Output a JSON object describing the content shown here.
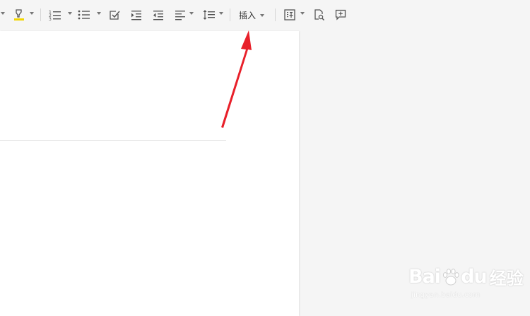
{
  "toolbar": {
    "insert_label": "插入",
    "icons": [
      "caret-down-icon",
      "highlight-marker-icon",
      "numbered-list-icon",
      "bulleted-list-icon",
      "checklist-icon",
      "increase-indent-icon",
      "decrease-indent-icon",
      "align-left-icon",
      "line-spacing-icon",
      "translate-icon",
      "find-document-icon",
      "add-comment-icon"
    ]
  },
  "colors": {
    "background": "#f5f5f5",
    "page": "#ffffff",
    "highlight_bar": "#f2d600",
    "arrow": "#e8202a"
  },
  "watermark": {
    "brand": "Bai",
    "brand_tail": "du",
    "brand_cn": "经验",
    "url": "jingyan.baidu.com"
  }
}
